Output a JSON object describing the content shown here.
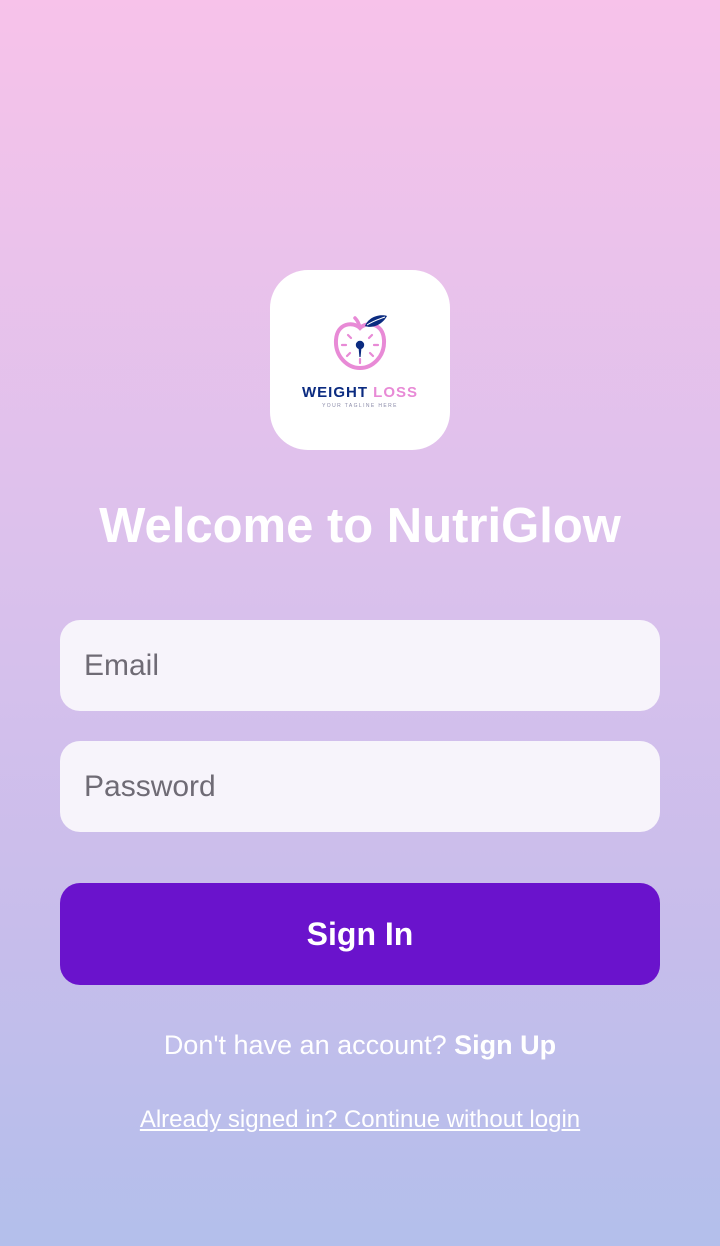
{
  "logo": {
    "icon": "apple-clock-icon",
    "title_part1": "WEIGHT",
    "title_part2": "LOSS",
    "tagline": "YOUR TAGLINE HERE",
    "colors": {
      "navy": "#0b2b80",
      "pink": "#e88ad6"
    }
  },
  "welcome": {
    "title": "Welcome to NutriGlow"
  },
  "form": {
    "email_placeholder": "Email",
    "password_placeholder": "Password",
    "signin_label": "Sign In"
  },
  "footer": {
    "prompt": "Don't have an account? ",
    "signup_label": "Sign Up",
    "continue_label": "Already signed in? Continue without login"
  },
  "theme": {
    "accent": "#6a13cc",
    "gradient_top": "#f7c2ea",
    "gradient_bottom": "#b3bfeb",
    "field_bg": "#f7f4fb"
  }
}
